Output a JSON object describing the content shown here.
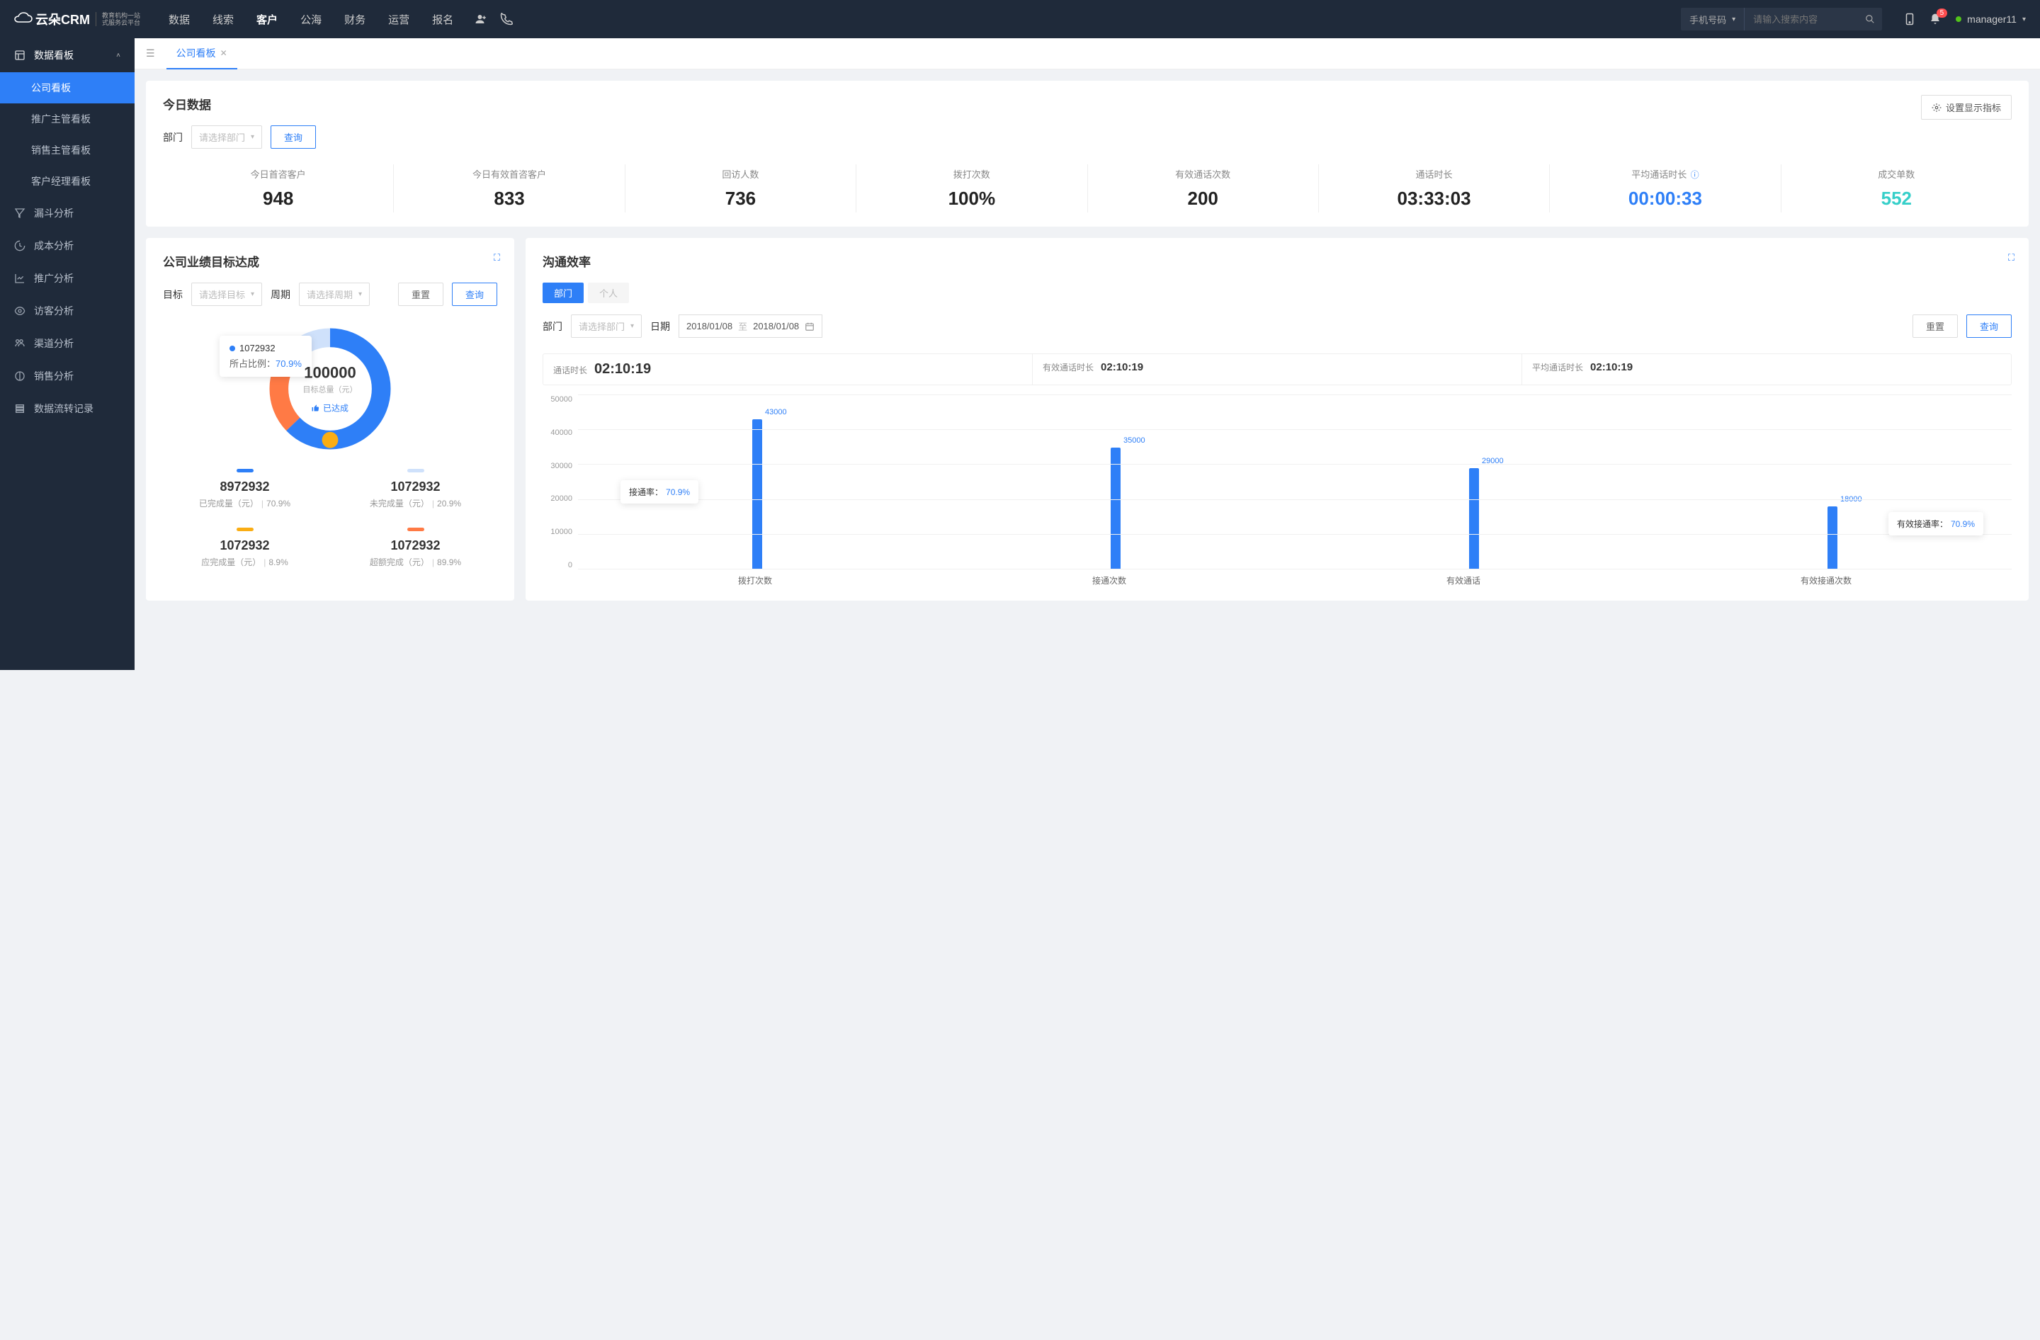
{
  "header": {
    "logo": "云朵CRM",
    "logo_sub1": "教育机构一站",
    "logo_sub2": "式服务云平台",
    "nav": [
      "数据",
      "线索",
      "客户",
      "公海",
      "财务",
      "运营",
      "报名"
    ],
    "nav_active_index": 2,
    "search_type": "手机号码",
    "search_placeholder": "请输入搜索内容",
    "badge_count": "5",
    "username": "manager11"
  },
  "sidebar": {
    "group": "数据看板",
    "items": [
      "公司看板",
      "推广主管看板",
      "销售主管看板",
      "客户经理看板"
    ],
    "active_index": 0,
    "links": [
      "漏斗分析",
      "成本分析",
      "推广分析",
      "访客分析",
      "渠道分析",
      "销售分析",
      "数据流转记录"
    ]
  },
  "tab": {
    "label": "公司看板"
  },
  "today": {
    "title": "今日数据",
    "dept_label": "部门",
    "dept_placeholder": "请选择部门",
    "query": "查询",
    "settings": "设置显示指标",
    "kpis": [
      {
        "label": "今日首咨客户",
        "value": "948",
        "cls": ""
      },
      {
        "label": "今日有效首咨客户",
        "value": "833",
        "cls": ""
      },
      {
        "label": "回访人数",
        "value": "736",
        "cls": ""
      },
      {
        "label": "拨打次数",
        "value": "100%",
        "cls": ""
      },
      {
        "label": "有效通话次数",
        "value": "200",
        "cls": ""
      },
      {
        "label": "通话时长",
        "value": "03:33:03",
        "cls": ""
      },
      {
        "label": "平均通话时长",
        "value": "00:00:33",
        "cls": "blue",
        "info": true
      },
      {
        "label": "成交单数",
        "value": "552",
        "cls": "cyan"
      }
    ]
  },
  "goal": {
    "title": "公司业绩目标达成",
    "target_label": "目标",
    "target_placeholder": "请选择目标",
    "period_label": "周期",
    "period_placeholder": "请选择周期",
    "reset": "重置",
    "query": "查询",
    "tooltip_value": "1072932",
    "tooltip_ratio_label": "所占比例：",
    "tooltip_ratio": "70.9%",
    "center_value": "100000",
    "center_label": "目标总量（元）",
    "status_text": "已达成",
    "legend": [
      {
        "num": "8972932",
        "label": "已完成量（元）",
        "pct": "70.9%",
        "cls": "lb-blue"
      },
      {
        "num": "1072932",
        "label": "未完成量（元）",
        "pct": "20.9%",
        "cls": "lb-lblue"
      },
      {
        "num": "1072932",
        "label": "应完成量（元）",
        "pct": "8.9%",
        "cls": "lb-orange"
      },
      {
        "num": "1072932",
        "label": "超额完成（元）",
        "pct": "89.9%",
        "cls": "lb-red"
      }
    ]
  },
  "comm": {
    "title": "沟通效率",
    "tab_dept": "部门",
    "tab_person": "个人",
    "dept_label": "部门",
    "dept_placeholder": "请选择部门",
    "date_label": "日期",
    "date_from": "2018/01/08",
    "date_to": "2018/01/08",
    "date_sep": "至",
    "reset": "重置",
    "query": "查询",
    "stats": [
      {
        "label": "通话时长",
        "value": "02:10:19",
        "big": true
      },
      {
        "label": "有效通话时长",
        "value": "02:10:19"
      },
      {
        "label": "平均通话时长",
        "value": "02:10:19"
      }
    ],
    "tooltip1_label": "接通率：",
    "tooltip1_pct": "70.9%",
    "tooltip2_label": "有效接通率：",
    "tooltip2_pct": "70.9%"
  },
  "chart_data": [
    {
      "type": "pie",
      "title": "公司业绩目标达成",
      "series": [
        {
          "name": "已完成量（元）",
          "value": 8972932,
          "pct": 70.9,
          "color": "#2e7ff7"
        },
        {
          "name": "未完成量（元）",
          "value": 1072932,
          "pct": 20.9,
          "color": "#cfe1fb"
        },
        {
          "name": "应完成量（元）",
          "value": 1072932,
          "pct": 8.9,
          "color": "#faad14"
        },
        {
          "name": "超额完成（元）",
          "value": 1072932,
          "pct": 89.9,
          "color": "#ff7a45"
        }
      ],
      "center_value": 100000,
      "center_label": "目标总量（元）"
    },
    {
      "type": "bar",
      "title": "沟通效率",
      "categories": [
        "拨打次数",
        "接通次数",
        "有效通话",
        "有效接通次数"
      ],
      "values": [
        43000,
        35000,
        29000,
        18000
      ],
      "ylabel": "",
      "ylim": [
        0,
        50000
      ],
      "yticks": [
        0,
        10000,
        20000,
        30000,
        40000,
        50000
      ],
      "annotations": [
        {
          "label": "接通率",
          "pct": 70.9
        },
        {
          "label": "有效接通率",
          "pct": 70.9
        }
      ]
    }
  ]
}
